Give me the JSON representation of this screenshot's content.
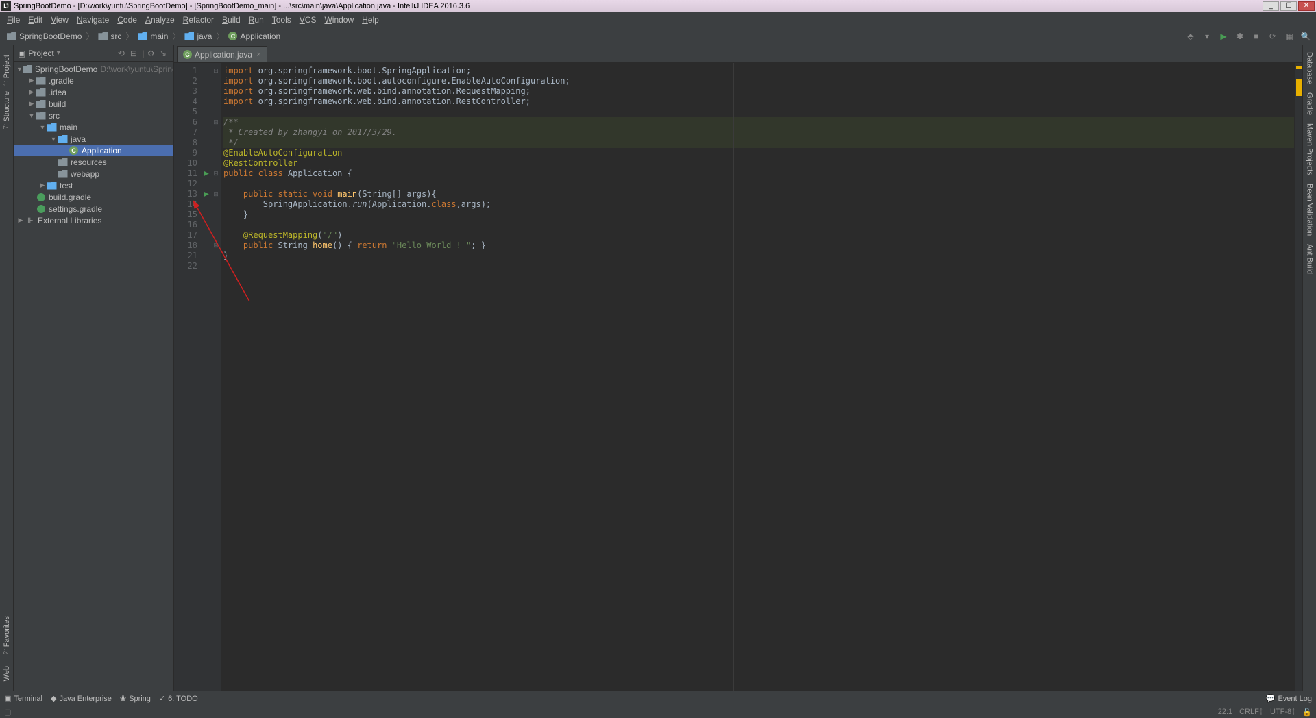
{
  "title_bar": {
    "text": "SpringBootDemo - [D:\\work\\yuntu\\SpringBootDemo] - [SpringBootDemo_main] - ...\\src\\main\\java\\Application.java - IntelliJ IDEA 2016.3.6"
  },
  "menu": [
    "File",
    "Edit",
    "View",
    "Navigate",
    "Code",
    "Analyze",
    "Refactor",
    "Build",
    "Run",
    "Tools",
    "VCS",
    "Window",
    "Help"
  ],
  "breadcrumbs": [
    {
      "icon": "folder",
      "label": "SpringBootDemo"
    },
    {
      "icon": "folder",
      "label": "src"
    },
    {
      "icon": "folder-blue",
      "label": "main"
    },
    {
      "icon": "folder-blue",
      "label": "java"
    },
    {
      "icon": "class",
      "label": "Application"
    }
  ],
  "sidebar": {
    "title": "Project",
    "items": [
      {
        "indent": 0,
        "arrow": "▼",
        "icon": "folder",
        "label": "SpringBootDemo",
        "path": "D:\\work\\yuntu\\SpringBoo"
      },
      {
        "indent": 1,
        "arrow": "▶",
        "icon": "folder",
        "label": ".gradle"
      },
      {
        "indent": 1,
        "arrow": "▶",
        "icon": "folder",
        "label": ".idea"
      },
      {
        "indent": 1,
        "arrow": "▶",
        "icon": "folder",
        "label": "build"
      },
      {
        "indent": 1,
        "arrow": "▼",
        "icon": "folder",
        "label": "src"
      },
      {
        "indent": 2,
        "arrow": "▼",
        "icon": "folder-blue",
        "label": "main"
      },
      {
        "indent": 3,
        "arrow": "▼",
        "icon": "folder-blue",
        "label": "java"
      },
      {
        "indent": 4,
        "arrow": "",
        "icon": "class",
        "label": "Application",
        "selected": true
      },
      {
        "indent": 3,
        "arrow": "",
        "icon": "folder",
        "label": "resources"
      },
      {
        "indent": 3,
        "arrow": "",
        "icon": "folder",
        "label": "webapp"
      },
      {
        "indent": 2,
        "arrow": "▶",
        "icon": "folder-blue",
        "label": "test"
      },
      {
        "indent": 1,
        "arrow": "",
        "icon": "gradle",
        "label": "build.gradle"
      },
      {
        "indent": 1,
        "arrow": "",
        "icon": "gradle",
        "label": "settings.gradle"
      },
      {
        "indent": 0,
        "arrow": "▶",
        "icon": "lib",
        "label": "External Libraries"
      }
    ]
  },
  "editor_tab": {
    "label": "Application.java"
  },
  "code_lines": [
    {
      "n": 1,
      "html": "<span class='k'>import </span><span class='n'>org.springframework.boot.SpringApplication;</span>"
    },
    {
      "n": 2,
      "html": "<span class='k'>import </span><span class='n'>org.springframework.boot.autoconfigure.</span><span class='cls'>EnableAutoConfiguration</span><span class='n'>;</span>"
    },
    {
      "n": 3,
      "html": "<span class='k'>import </span><span class='n'>org.springframework.web.bind.annotation.</span><span class='cls'>RequestMapping</span><span class='n'>;</span>"
    },
    {
      "n": 4,
      "html": "<span class='k'>import </span><span class='n'>org.springframework.web.bind.annotation.</span><span class='cls'>RestController</span><span class='n'>;</span>"
    },
    {
      "n": 5,
      "html": ""
    },
    {
      "n": 6,
      "html": "<span class='c'>/**</span>",
      "cb": true
    },
    {
      "n": 7,
      "html": "<span class='c'> * Created by zhangyi on 2017/3/29.</span>",
      "cb": true
    },
    {
      "n": 8,
      "html": "<span class='c'> */</span>",
      "cb": true
    },
    {
      "n": 9,
      "html": "<span class='a'>@EnableAutoConfiguration</span>"
    },
    {
      "n": 10,
      "html": "<span class='a'>@RestController</span>"
    },
    {
      "n": 11,
      "html": "<span class='k'>public class </span><span class='n'>Application {</span>",
      "run": true
    },
    {
      "n": 12,
      "html": ""
    },
    {
      "n": 13,
      "html": "    <span class='k'>public static void </span><span class='f'>main</span><span class='n'>(String[] args){</span>",
      "run": true
    },
    {
      "n": 14,
      "html": "        <span class='n'>SpringApplication.</span><span class='i'>run</span><span class='n'>(Application.</span><span class='k'>class</span><span class='n'>,args);</span>"
    },
    {
      "n": 15,
      "html": "    <span class='n'>}</span>"
    },
    {
      "n": 16,
      "html": ""
    },
    {
      "n": 17,
      "html": "    <span class='a'>@RequestMapping</span><span class='n'>(</span><span class='s'>\"/\"</span><span class='n'>)</span>"
    },
    {
      "n": 18,
      "html": "    <span class='k'>public </span><span class='n'>String </span><span class='f'>home</span><span class='n'>() { </span><span class='k'>return </span><span class='s'>\"Hello World ! \"</span><span class='n'>; }</span>",
      "fold": true
    },
    {
      "n": 21,
      "html": "<span class='n'>}</span>"
    },
    {
      "n": 22,
      "html": ""
    }
  ],
  "left_gutter_tabs": [
    {
      "num": "1",
      "label": "Project"
    },
    {
      "num": "7",
      "label": "Structure"
    }
  ],
  "left_gutter_bottom": [
    {
      "num": "2",
      "label": "Favorites"
    },
    {
      "num": "",
      "label": "Web"
    }
  ],
  "right_gutter_tabs": [
    "Database",
    "Gradle",
    "Maven Projects",
    "Bean Validation",
    "Ant Build"
  ],
  "right_gutter_icons": [
    "m"
  ],
  "bottom_tools": [
    {
      "icon": "▣",
      "label": "Terminal"
    },
    {
      "icon": "◆",
      "label": "Java Enterprise"
    },
    {
      "icon": "❀",
      "label": "Spring"
    },
    {
      "icon": "✓",
      "label": "6: TODO"
    }
  ],
  "bottom_right": {
    "label": "Event Log"
  },
  "status": {
    "pos": "22:1",
    "crlf": "CRLF‡",
    "enc": "UTF-8‡",
    "lock": "🔓"
  }
}
